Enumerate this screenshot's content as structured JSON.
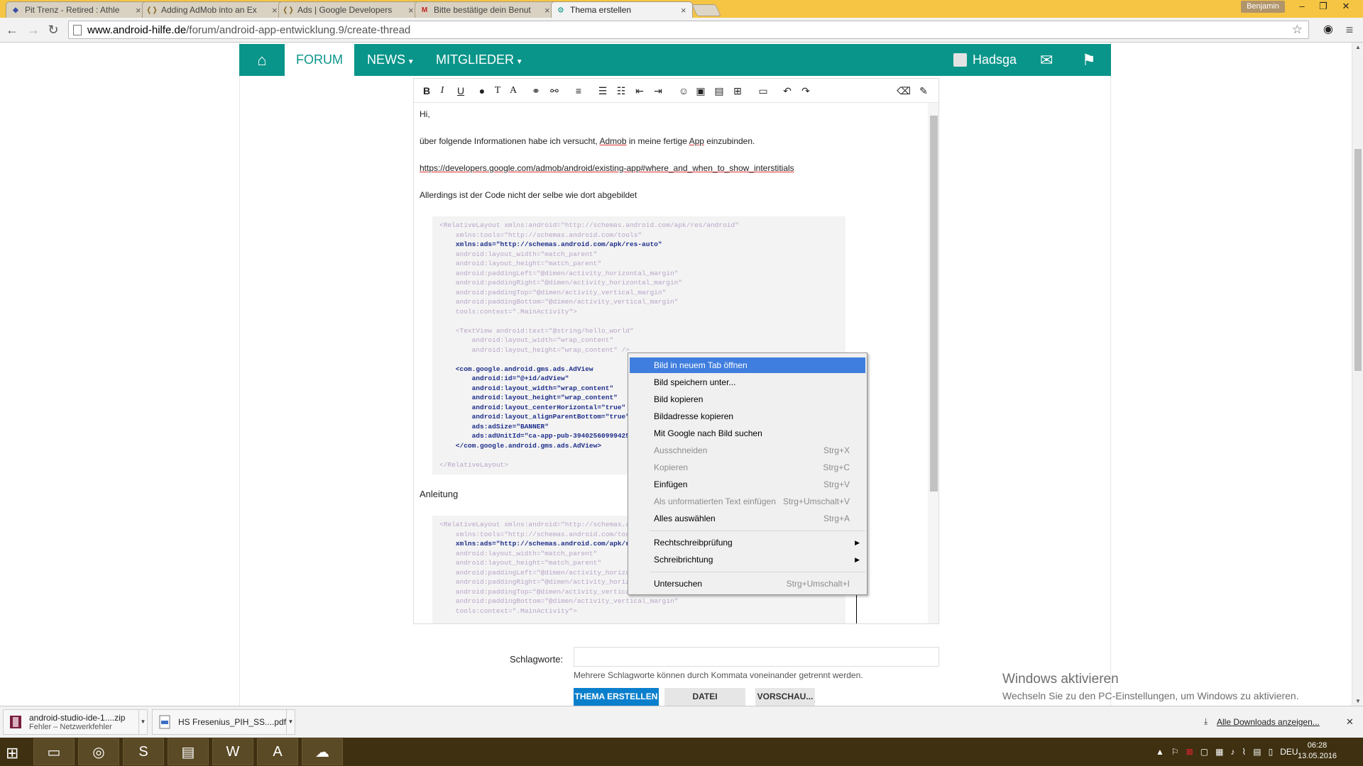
{
  "browser": {
    "tabs": [
      {
        "title": "Pit Trenz - Retired : Athle",
        "icon": "blue-game-icon"
      },
      {
        "title": "Adding AdMob into an Ex",
        "icon": "android-icon"
      },
      {
        "title": "Ads  |  Google Developers",
        "icon": "android-icon"
      },
      {
        "title": "Bitte bestätige dein Benut",
        "icon": "gmail-icon"
      },
      {
        "title": "Thema erstellen",
        "icon": "android-icon"
      }
    ],
    "user_badge": "Benjamin",
    "url_host": "www.android-hilfe.de",
    "url_path": "/forum/android-app-entwicklung.9/create-thread"
  },
  "site_nav": {
    "home_icon": "home-icon",
    "forum": "FORUM",
    "news": "NEWS",
    "members": "MITGLIEDER",
    "username": "Hadsga",
    "mail_icon": "envelope-icon",
    "flag_icon": "flag-icon",
    "color": "#0a958a"
  },
  "editor": {
    "toolbar_buttons": [
      "B",
      "I",
      "U",
      "💧",
      "Tꟾ",
      "A",
      "🔗",
      "⛓",
      "≡",
      "•",
      "1.",
      "⇤",
      "⇥",
      "☺",
      "▣",
      "▤",
      "⊞",
      "💾",
      "↶",
      "↷",
      "⌫",
      "🔧"
    ],
    "greeting": "Hi,",
    "line1_before": "über folgende Informationen habe ich versucht, ",
    "line1_admob": "Admob",
    "line1_mid": " in meine fertige ",
    "line1_app": "App",
    "line1_after": " einzubinden.",
    "link": "https://developers.google.com/admob/android/existing-app#where_and_when_to_show_interstitials",
    "line3": "Allerdings ist der Code nicht der selbe wie dort abgebildet",
    "anleitung": "Anleitung",
    "code1": [
      {
        "cls": "g",
        "text": "<RelativeLayout xmlns:android=\"http://schemas.android.com/apk/res/android\""
      },
      {
        "cls": "g",
        "text": "    xmlns:tools=\"http://schemas.android.com/tools\""
      },
      {
        "cls": "b",
        "text": "    xmlns:ads=\"http://schemas.android.com/apk/res-auto\""
      },
      {
        "cls": "g",
        "text": "    android:layout_width=\"match_parent\""
      },
      {
        "cls": "g",
        "text": "    android:layout_height=\"match_parent\""
      },
      {
        "cls": "g",
        "text": "    android:paddingLeft=\"@dimen/activity_horizontal_margin\""
      },
      {
        "cls": "g",
        "text": "    android:paddingRight=\"@dimen/activity_horizontal_margin\""
      },
      {
        "cls": "g",
        "text": "    android:paddingTop=\"@dimen/activity_vertical_margin\""
      },
      {
        "cls": "g",
        "text": "    android:paddingBottom=\"@dimen/activity_vertical_margin\""
      },
      {
        "cls": "g",
        "text": "    tools:context=\".MainActivity\">"
      },
      {
        "cls": "g",
        "text": ""
      },
      {
        "cls": "g",
        "text": "    <TextView android:text=\"@string/hello_world\""
      },
      {
        "cls": "g",
        "text": "        android:layout_width=\"wrap_content\""
      },
      {
        "cls": "g",
        "text": "        android:layout_height=\"wrap_content\" />"
      },
      {
        "cls": "g",
        "text": ""
      },
      {
        "cls": "b",
        "text": "    <com.google.android.gms.ads.AdView"
      },
      {
        "cls": "b",
        "text": "        android:id=\"@+id/adView\""
      },
      {
        "cls": "b",
        "text": "        android:layout_width=\"wrap_content\""
      },
      {
        "cls": "b",
        "text": "        android:layout_height=\"wrap_content\""
      },
      {
        "cls": "b",
        "text": "        android:layout_centerHorizontal=\"true\""
      },
      {
        "cls": "b",
        "text": "        android:layout_alignParentBottom=\"true\""
      },
      {
        "cls": "b",
        "text": "        ads:adSize=\"BANNER\""
      },
      {
        "cls": "b",
        "text": "        ads:adUnitId=\"ca-app-pub-3940256099942544"
      },
      {
        "cls": "b",
        "text": "    </com.google.android.gms.ads.AdView>"
      },
      {
        "cls": "g",
        "text": ""
      },
      {
        "cls": "g",
        "text": "</RelativeLayout>"
      }
    ],
    "code2": [
      {
        "cls": "g",
        "text": "<RelativeLayout xmlns:android=\"http://schemas.and"
      },
      {
        "cls": "g",
        "text": "    xmlns:tools=\"http://schemas.android.com/tool"
      },
      {
        "cls": "b",
        "text": "    xmlns:ads=\"http://schemas.android.com/apk/re"
      },
      {
        "cls": "g",
        "text": "    android:layout_width=\"match_parent\""
      },
      {
        "cls": "g",
        "text": "    android:layout_height=\"match_parent\""
      },
      {
        "cls": "g",
        "text": "    android:paddingLeft=\"@dimen/activity_horizontal_margin\""
      },
      {
        "cls": "g",
        "text": "    android:paddingRight=\"@dimen/activity_horizontal_margin\""
      },
      {
        "cls": "g",
        "text": "    android:paddingTop=\"@dimen/activity_vertical_margin\""
      },
      {
        "cls": "g",
        "text": "    android:paddingBottom=\"@dimen/activity_vertical_margin\""
      },
      {
        "cls": "g",
        "text": "    tools:context=\".MainActivity\">"
      }
    ]
  },
  "context_menu": {
    "items": [
      {
        "label": "Bild in neuem Tab öffnen",
        "shortcut": "",
        "state": "highlight"
      },
      {
        "label": "Bild speichern unter...",
        "shortcut": "",
        "state": "normal"
      },
      {
        "label": "Bild kopieren",
        "shortcut": "",
        "state": "normal"
      },
      {
        "label": "Bildadresse kopieren",
        "shortcut": "",
        "state": "normal"
      },
      {
        "label": "Mit Google nach Bild suchen",
        "shortcut": "",
        "state": "normal"
      },
      {
        "label": "Ausschneiden",
        "shortcut": "Strg+X",
        "state": "disabled"
      },
      {
        "label": "Kopieren",
        "shortcut": "Strg+C",
        "state": "disabled"
      },
      {
        "label": "Einfügen",
        "shortcut": "Strg+V",
        "state": "normal"
      },
      {
        "label": "Als unformatierten Text einfügen",
        "shortcut": "Strg+Umschalt+V",
        "state": "disabled"
      },
      {
        "label": "Alles auswählen",
        "shortcut": "Strg+A",
        "state": "normal"
      },
      {
        "label": "Rechtschreibprüfung",
        "shortcut": "",
        "state": "submenu"
      },
      {
        "label": "Schreibrichtung",
        "shortcut": "",
        "state": "submenu"
      },
      {
        "label": "Untersuchen",
        "shortcut": "Strg+Umschalt+I",
        "state": "normal"
      }
    ]
  },
  "form": {
    "tags_label": "Schlagworte:",
    "tags_hint": "Mehrere Schlagworte können durch Kommata voneinander getrennt werden.",
    "btn_create": "THEMA ERSTELLEN",
    "btn_upload": "DATEI HOCHLADEN",
    "btn_preview": "VORSCHAU..."
  },
  "windows_notice": {
    "title": "Windows aktivieren",
    "text": "Wechseln Sie zu den PC-Einstellungen, um Windows zu aktivieren."
  },
  "downloads": {
    "items": [
      {
        "name": "android-studio-ide-1....zip",
        "status": "Fehler – Netzwerkfehler"
      },
      {
        "name": "HS Fresenius_PIH_SS....pdf",
        "status": ""
      }
    ],
    "show_all": "Alle Downloads anzeigen..."
  },
  "taskbar": {
    "apps": [
      "explorer-icon",
      "chrome-icon",
      "skype-icon",
      "pdf-icon",
      "word-icon",
      "android-studio-icon",
      "network-icon"
    ],
    "language": "DEU",
    "time": "06:28",
    "date": "13.05.2016"
  }
}
